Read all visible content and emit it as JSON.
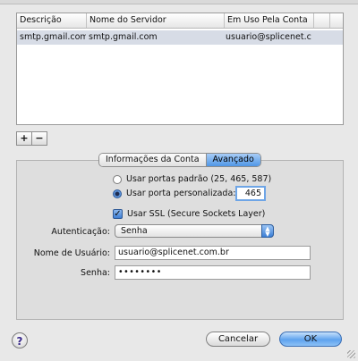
{
  "table": {
    "columns": [
      "Descrição",
      "Nome do Servidor",
      "Em Uso Pela Conta"
    ],
    "rows": [
      [
        "smtp.gmail.com",
        "smtp.gmail.com",
        "usuario@splicenet.c..."
      ]
    ]
  },
  "list_buttons": {
    "add": "+",
    "remove": "−"
  },
  "tabs": {
    "account_info": "Informações da Conta",
    "advanced": "Avançado",
    "selected": "Avançado"
  },
  "ports": {
    "default_label": "Usar portas padrão (25, 465, 587)",
    "custom_label": "Usar porta personalizada:",
    "custom_value": "465",
    "selected": "custom"
  },
  "ssl": {
    "label": "Usar SSL (Secure Sockets Layer)",
    "checked": true
  },
  "auth": {
    "label": "Autenticação:",
    "value": "Senha"
  },
  "username": {
    "label": "Nome de Usuário:",
    "value": "usuario@splicenet.com.br"
  },
  "password": {
    "label": "Senha:",
    "value": "••••••••"
  },
  "buttons": {
    "help": "?",
    "cancel": "Cancelar",
    "ok": "OK"
  },
  "colors": {
    "accent": "#5ea2ee",
    "selection": "#d7dce6"
  }
}
